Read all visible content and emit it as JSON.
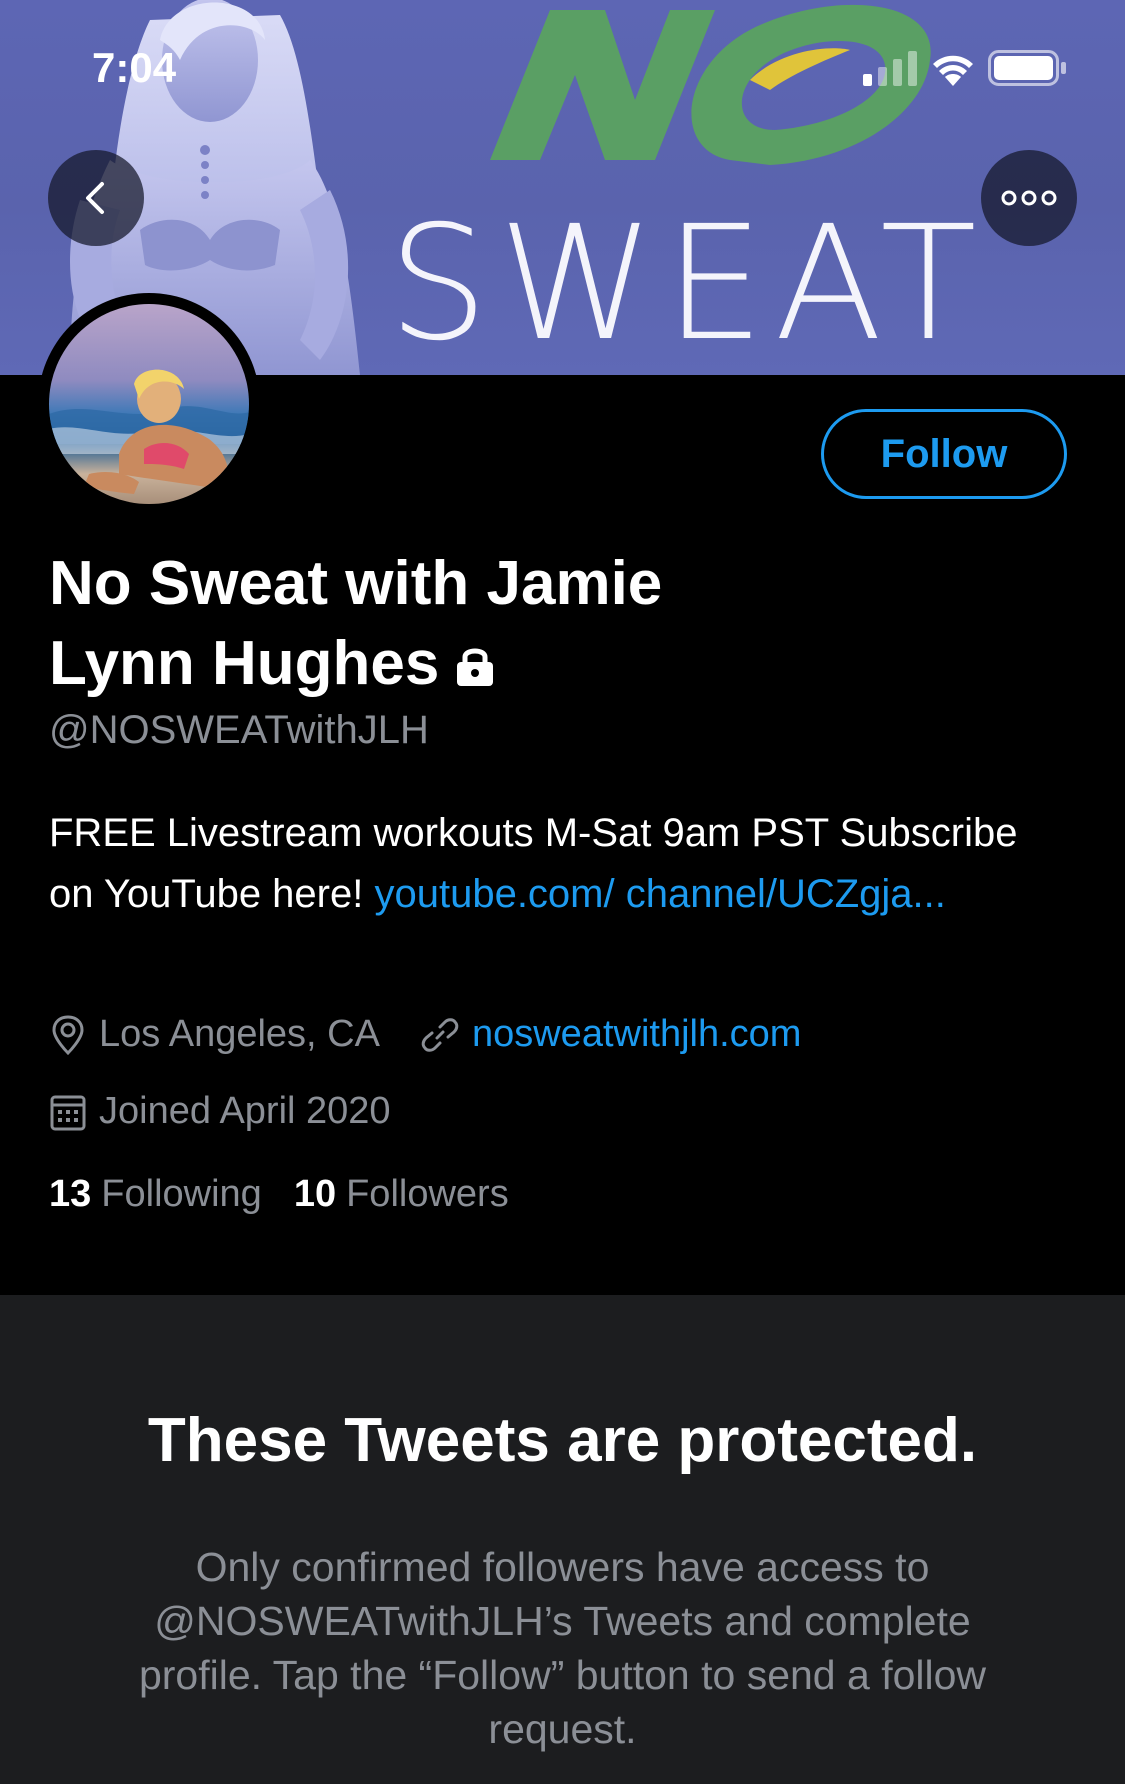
{
  "status_bar": {
    "time": "7:04",
    "icons": [
      "signal-icon",
      "wifi-icon",
      "battery-icon"
    ]
  },
  "banner": {
    "logo_top": "NO",
    "logo_bottom": "SWEAT",
    "accent_green": "#5a9f64",
    "accent_yellow": "#e0c43a",
    "background": "#5d66b4"
  },
  "nav": {
    "back_icon": "chevron-left-icon",
    "more_icon": "more-dots-icon"
  },
  "profile": {
    "display_name_line1": "No Sweat with Jamie",
    "display_name_line2": "Lynn Hughes",
    "protected_icon": "lock-icon",
    "handle": "@NOSWEATwithJLH",
    "follow_label": "Follow",
    "bio_text": "FREE Livestream workouts M-Sat 9am PST Subscribe on YouTube here! ",
    "bio_link": "youtube.com/ channel/UCZgja...",
    "location": "Los Angeles, CA",
    "website": "nosweatwithjlh.com",
    "joined": "Joined April 2020",
    "following_count": "13",
    "following_label": "Following",
    "followers_count": "10",
    "followers_label": "Followers"
  },
  "protected": {
    "title": "These Tweets are protected.",
    "message": "Only confirmed followers have access to @NOSWEATwithJLH’s Tweets and complete profile. Tap the “Follow” button to send a follow request."
  },
  "colors": {
    "link": "#1d9bf0",
    "secondary_text": "#8b8f96",
    "panel": "#1c1d1f"
  }
}
